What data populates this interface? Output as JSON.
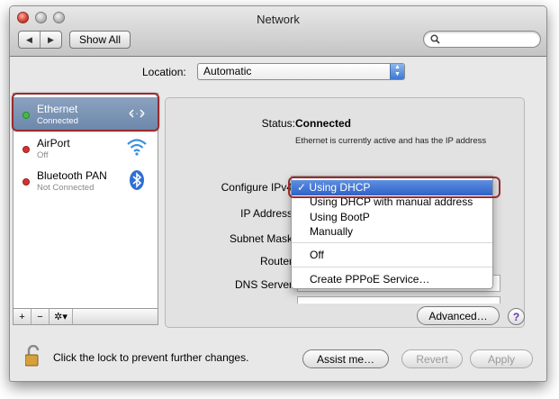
{
  "window": {
    "title": "Network"
  },
  "toolbar": {
    "back_glyph": "◀",
    "forward_glyph": "▶",
    "show_all_label": "Show All",
    "search_placeholder": "",
    "search_icon": "search-icon"
  },
  "location": {
    "label": "Location:",
    "value": "Automatic"
  },
  "services": [
    {
      "name": "Ethernet",
      "status": "Connected",
      "status_color": "#3fbf3f",
      "icon": "ethernet-icon",
      "selected": true
    },
    {
      "name": "AirPort",
      "status": "Off",
      "status_color": "#d83030",
      "icon": "wifi-icon",
      "selected": false
    },
    {
      "name": "Bluetooth PAN",
      "status": "Not Connected",
      "status_color": "#d83030",
      "icon": "bluetooth-icon",
      "selected": false
    }
  ],
  "sidebar_footer": {
    "add": "+",
    "remove": "−",
    "gear": "✲▾"
  },
  "detail": {
    "status_label": "Status:",
    "status_value": "Connected",
    "status_description": "Ethernet is currently active and has the IP address",
    "configure_label": "Configure IPv4",
    "ip_label": "IP Address",
    "subnet_label": "Subnet Mask",
    "router_label": "Router",
    "dns_label": "DNS Server"
  },
  "dropdown": {
    "selected_check": "✓",
    "options": [
      "Using DHCP",
      "Using DHCP with manual address",
      "Using BootP",
      "Manually",
      "Off",
      "Create PPPoE Service…"
    ]
  },
  "buttons": {
    "advanced": "Advanced…",
    "help": "?",
    "assist": "Assist me…",
    "revert": "Revert",
    "apply": "Apply"
  },
  "lock_text": "Click the lock to prevent further changes.",
  "colors": {
    "selection": "#6d88ab",
    "highlight_ring": "#9a2b2e",
    "menu_highlight": "#2e62c9"
  }
}
